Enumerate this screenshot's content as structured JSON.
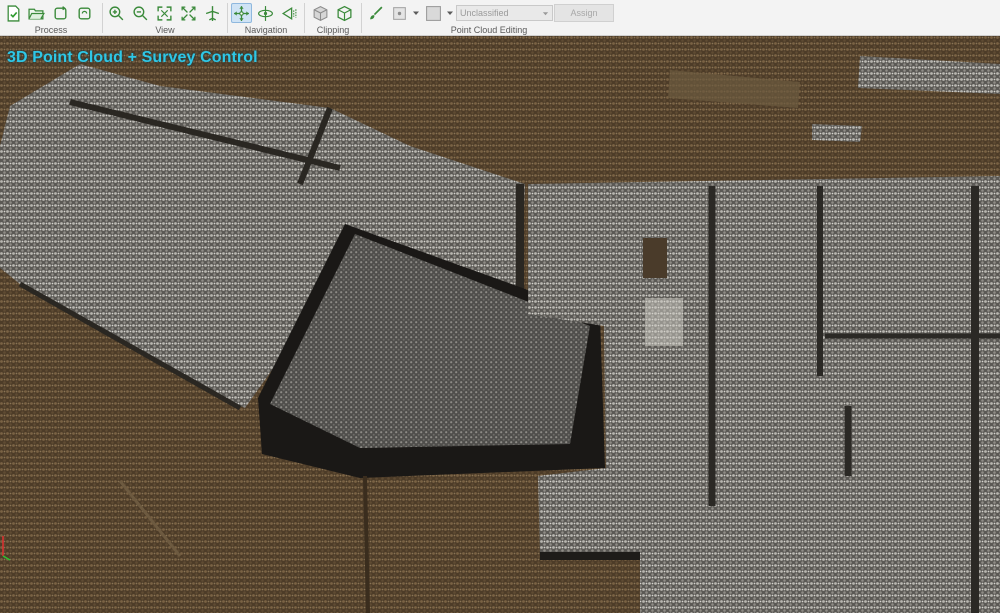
{
  "toolbar": {
    "groups": [
      {
        "label": "Process"
      },
      {
        "label": "View"
      },
      {
        "label": "Navigation"
      },
      {
        "label": "Clipping"
      },
      {
        "label": "Point Cloud Editing"
      }
    ],
    "editing": {
      "class_value": "Unclassified",
      "assign_label": "Assign"
    }
  },
  "viewport": {
    "overlay_title": "3D Point Cloud + Survey Control"
  },
  "colors": {
    "toolbar_bg": "#f3f3f3",
    "overlay_title": "#2fc7e6",
    "accent_active": "#cfe3f5",
    "ground": "#5a4630",
    "roof": "#8d8b86"
  },
  "icons": {
    "process": [
      "check-document-icon",
      "open-folder-icon",
      "refresh-icon",
      "sync-icon"
    ],
    "view": [
      "zoom-in-icon",
      "zoom-out-icon",
      "fit-extent-icon",
      "expand-arrows-icon",
      "airplane-icon"
    ],
    "navigation": [
      "pan-arrows-icon",
      "orbit-icon",
      "walk-triangle-icon"
    ],
    "clipping": [
      "box-icon",
      "box-open-icon"
    ],
    "editing": [
      "brush-icon",
      "point-select-icon",
      "color-swatch-icon"
    ]
  }
}
